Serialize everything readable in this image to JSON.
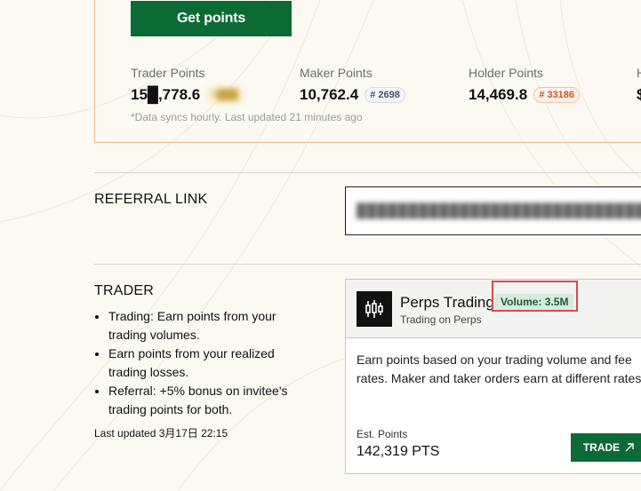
{
  "points_section": {
    "get_points_label": "Get points",
    "stats": [
      {
        "label": "Trader Points",
        "value": "15█,778.6",
        "rank": "#███"
      },
      {
        "label": "Maker Points",
        "value": "10,762.4",
        "rank": "# 2698"
      },
      {
        "label": "Holder Points",
        "value": "14,469.8",
        "rank": "# 33186"
      },
      {
        "label": "H",
        "value": "$"
      }
    ],
    "sync_note": "*Data syncs hourly. Last updated 21 minutes ago"
  },
  "referral": {
    "title": "REFERRAL LINK",
    "link": "███████████████████████████████"
  },
  "trader": {
    "title": "TRADER",
    "bullets": [
      "Trading: Earn points from your trading volumes.",
      "Earn points from your realized trading losses.",
      "Referral: +5% bonus on invitee's trading points for both."
    ],
    "last_updated": "Last updated 3月17日 22:15"
  },
  "perps_card": {
    "title": "Perps Trading",
    "subtitle": "Trading on Perps",
    "volume_badge": "Volume: 3.5M",
    "description": "Earn points based on your trading volume and fee rates. Maker and taker orders earn at different rates.",
    "est_label": "Est. Points",
    "est_value": "142,319 PTS",
    "trade_label": "TRADE",
    "icon": "candlestick-icon",
    "trade_icon": "arrow-up-right-icon"
  },
  "colors": {
    "accent_green": "#0c6b35",
    "highlight_red": "#e0484c",
    "card_border_orange": "#e9b58c",
    "background": "#fbf9f1"
  }
}
